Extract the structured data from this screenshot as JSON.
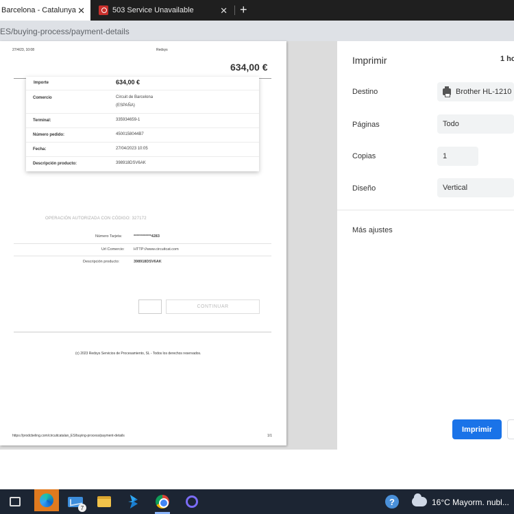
{
  "browser": {
    "tabs": [
      {
        "title": "Barcelona - Catalunya",
        "active": true
      },
      {
        "title": "503 Service Unavailable",
        "active": false
      }
    ],
    "close_glyph": "✕",
    "new_tab_glyph": "+",
    "url": "ES/buying-process/payment-details"
  },
  "page": {
    "header_left": "27/4/23, 10:08",
    "header_center": "Redsys",
    "amount_top": "634,00 €",
    "rows": [
      {
        "label": "Importe",
        "value": "634,00 €"
      },
      {
        "label": "Comercio",
        "value": "Circuit de Barcelona",
        "value2": "(ESPAÑA)"
      },
      {
        "label": "Terminal:",
        "value": "335934659-1"
      },
      {
        "label": "Número pedido:",
        "value": "4500158044B7"
      },
      {
        "label": "Fecha:",
        "value": "27/04/2023  10:05"
      },
      {
        "label": "Descripción producto:",
        "value": "398918DSV6AK"
      }
    ],
    "auth_text": "OPERACIÓN AUTORIZADA CON CÓDIGO:  327172",
    "card_label": "Número Tarjeta:",
    "card_value": "************4283",
    "url_label": "Url Comercio:",
    "url_value": "HTTP://www.circuitcat.com",
    "desc_label": "Descripción producto:",
    "desc_value": "398918DSV6AK",
    "continue_label": "CONTINUAR",
    "copyright": "(c) 2023 Redsys Servicios de Procesamiento, SL - Todos los derechos reservados.",
    "footer_url": "https://prodcbeling.com/circuitcatalan_ES/buying-process/payment-details",
    "footer_page": "1/1"
  },
  "print_panel": {
    "title": "Imprimir",
    "sheet_count": "1 ho",
    "destination_label": "Destino",
    "destination_value": "Brother HL-1210",
    "pages_label": "Páginas",
    "pages_value": "Todo",
    "copies_label": "Copias",
    "copies_value": "1",
    "layout_label": "Diseño",
    "layout_value": "Vertical",
    "more_settings": "Más ajustes",
    "print_button": "Imprimir"
  },
  "taskbar": {
    "mail_badge": "7",
    "help_glyph": "?",
    "weather": "16°C  Mayorm. nubl..."
  }
}
